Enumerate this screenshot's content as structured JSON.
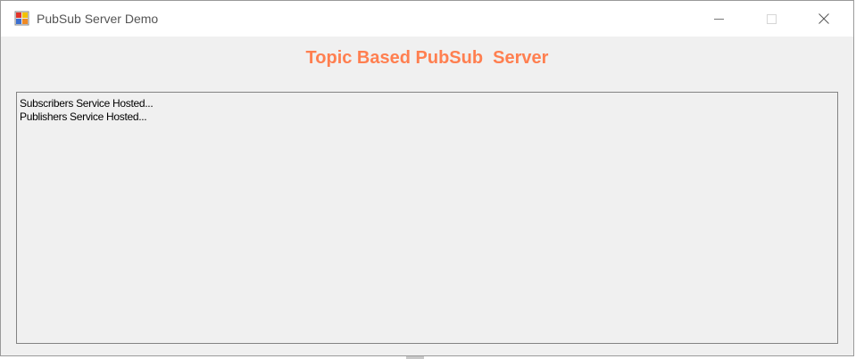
{
  "window": {
    "title": "PubSub Server Demo",
    "icon": "app-icon",
    "controls": {
      "minimize": "minimize-icon",
      "maximize": "maximize-icon",
      "close": "close-icon"
    }
  },
  "main": {
    "heading": "Topic Based PubSub  Server",
    "heading_color": "#ff7f50",
    "log": [
      "Subscribers Service Hosted...",
      "Publishers Service Hosted..."
    ]
  }
}
